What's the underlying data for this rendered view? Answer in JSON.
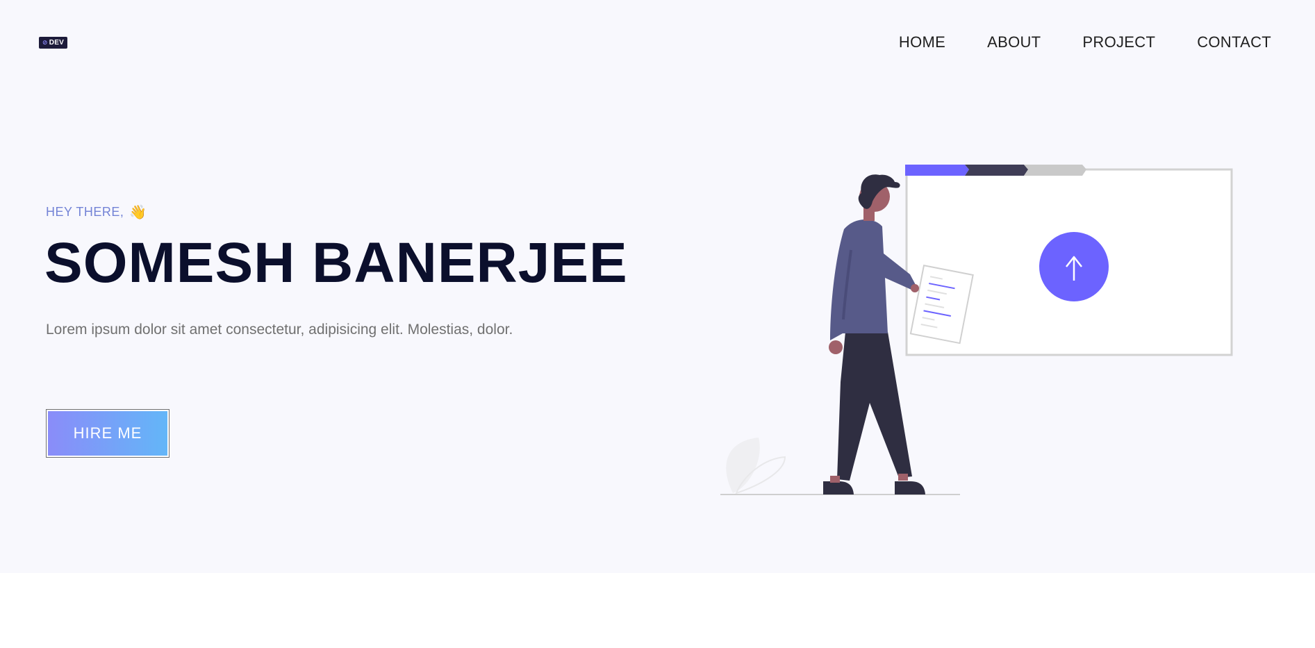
{
  "header": {
    "logo_text": "DEV",
    "nav": [
      {
        "label": "HOME"
      },
      {
        "label": "ABOUT"
      },
      {
        "label": "PROJECT"
      },
      {
        "label": "CONTACT"
      }
    ]
  },
  "hero": {
    "greeting": "HEY THERE,",
    "wave_emoji": "👋",
    "name": "SOMESH BANERJEE",
    "description": "Lorem ipsum dolor sit amet consectetur, adipisicing elit. Molestias, dolor.",
    "cta_label": "HIRE ME"
  },
  "colors": {
    "hero_bg": "#f8f8fd",
    "accent_purple": "#6c63ff",
    "name_color": "#0b0f2c",
    "greeting_color": "#7383d6",
    "button_gradient_start": "#8a8cf9",
    "button_gradient_end": "#63b6f8"
  },
  "illustration": {
    "icon": "upload-arrow-icon",
    "progress_steps": 3
  }
}
